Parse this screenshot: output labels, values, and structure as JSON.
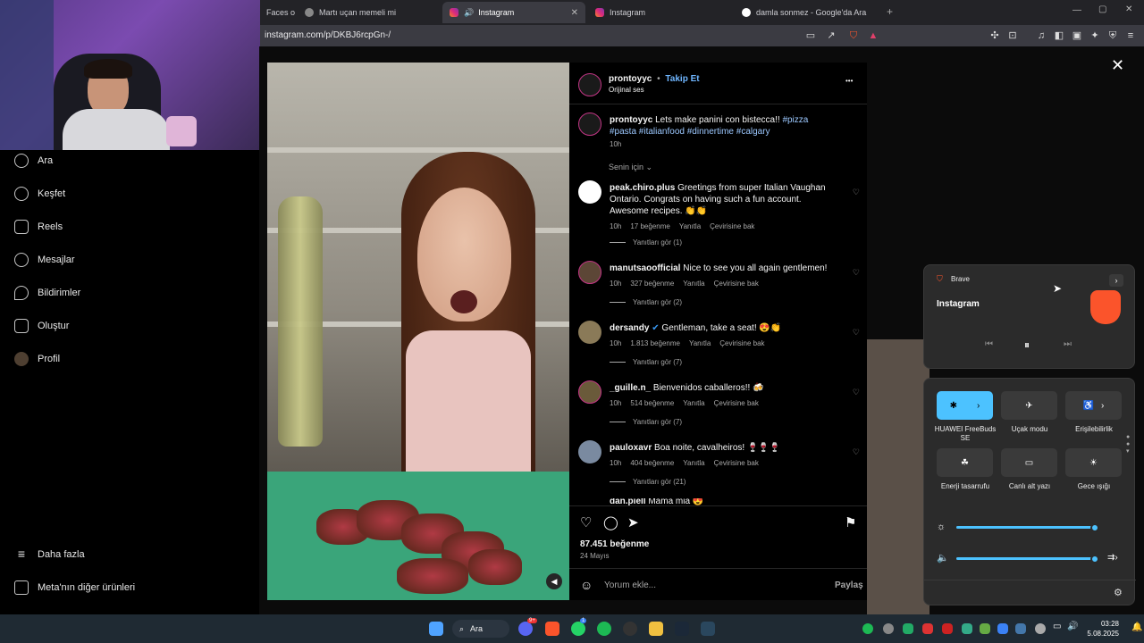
{
  "browser": {
    "tabs": [
      {
        "label": "Faces o",
        "active": false
      },
      {
        "label": "Martı uçan memeli mi",
        "active": false
      },
      {
        "label": "Instagram",
        "active": true
      },
      {
        "label": "Instagram",
        "active": false
      },
      {
        "label": "damla sonmez - Google'da Ara",
        "active": false
      }
    ],
    "url": "instagram.com/p/DKBJ6rcpGn-/"
  },
  "sidenav": {
    "items": [
      "Ara",
      "Keşfet",
      "Reels",
      "Mesajlar",
      "Bildirimler",
      "Oluştur",
      "Profil"
    ],
    "more": "Daha fazla",
    "meta": "Meta'nın diğer ürünleri"
  },
  "post": {
    "author": "prontoyyc",
    "follow": "Takip Et",
    "separator": "•",
    "audio": "Orijinal ses",
    "more": "•••",
    "caption_user": "prontoyyc",
    "caption_text": "Lets make panini con bistecca!!",
    "caption_tags": "#pizza #pasta #italianfood #dinnertime #calgary",
    "caption_time": "10h",
    "sort": "Senin için",
    "likes": "87.451 beğenme",
    "date": "24 Mayıs",
    "comment_placeholder": "Yorum ekle...",
    "share": "Paylaş"
  },
  "comments": [
    {
      "user": "peak.chiro.plus",
      "text": "Greetings from super Italian Vaughan Ontario. Congrats on having such a fun account. Awesome recipes. 👏👏",
      "time": "10h",
      "likes": "17 beğenme",
      "reply": "Yanıtla",
      "translate": "Çevirisine bak",
      "replies": "Yanıtları gör (1)"
    },
    {
      "user": "manutsaoofficial",
      "text": "Nice to see you all again gentlemen!",
      "time": "10h",
      "likes": "327 beğenme",
      "reply": "Yanıtla",
      "translate": "Çevirisine bak",
      "replies": "Yanıtları gör (2)"
    },
    {
      "user": "dersandy",
      "text": "Gentleman, take a seat! 😍👏",
      "time": "10h",
      "likes": "1.813 beğenme",
      "reply": "Yanıtla",
      "translate": "Çevirisine bak",
      "replies": "Yanıtları gör (7)"
    },
    {
      "user": "_guille.n_",
      "text": "Bienvenidos caballeros!! 🍻",
      "time": "10h",
      "likes": "514 beğenme",
      "reply": "Yanıtla",
      "translate": "Çevirisine bak",
      "replies": "Yanıtları gör (7)"
    },
    {
      "user": "pauloxavr",
      "text": "Boa noite, cavalheiros! 🍷🍷🍷",
      "time": "10h",
      "likes": "404 beğenme",
      "reply": "Yanıtla",
      "translate": "Çevirisine bak",
      "replies": "Yanıtları gör (21)"
    },
    {
      "user": "dan.piell",
      "text": "Mama mia 😍"
    }
  ],
  "media_flyout": {
    "app": "Brave",
    "title": "Instagram"
  },
  "quick_settings": {
    "tiles": [
      "HUAWEI FreeBuds SE",
      "Uçak modu",
      "Erişilebilirlik",
      "Enerji tasarrufu",
      "Canlı alt yazı",
      "Gece ışığı"
    ],
    "brightness": 0.98,
    "volume": 0.98
  },
  "taskbar": {
    "search": "Ara",
    "time": "03:28",
    "date": "5.08.2025",
    "badge_discord": "9+",
    "badge_whatsapp": "1"
  },
  "colors": {
    "accent": "#4cc2ff",
    "link": "#9cc8ff",
    "taskbar": "#1f2a33"
  }
}
